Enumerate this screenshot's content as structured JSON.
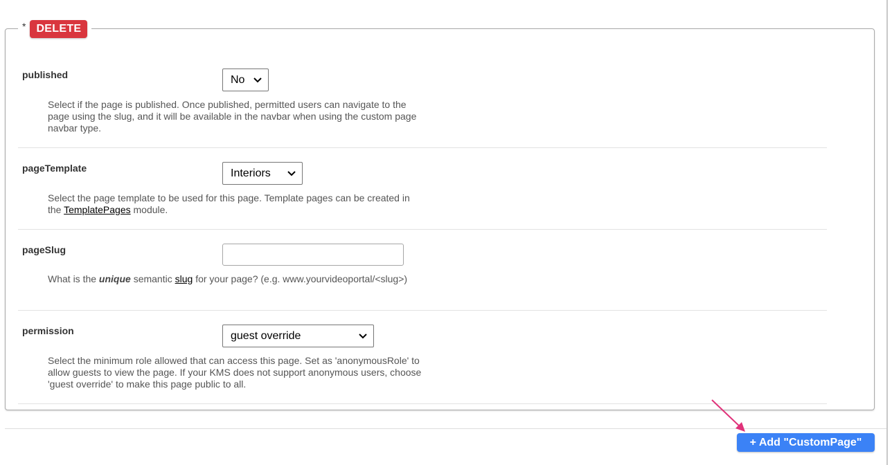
{
  "legend": {
    "asterisk": "*",
    "delete_label": "DELETE"
  },
  "fields": [
    {
      "label": "published",
      "control": "select",
      "value": "No",
      "description": "Select if the page is published. Once published, permitted users can navigate to the page using the slug, and it will be available in the navbar when using the custom page navbar type."
    },
    {
      "label": "pageTemplate",
      "control": "select",
      "value": "Interiors",
      "description_before": "Select the page template to be used for this page. Template pages can be created in the ",
      "description_link": "TemplatePages",
      "description_after": " module."
    },
    {
      "label": "pageSlug",
      "control": "text",
      "value": "",
      "description_part1": "What is the ",
      "description_emphasis": "unique",
      "description_part2": " semantic ",
      "description_link": "slug",
      "description_part3": " for your page? (e.g. www.yourvideoportal/<slug>)"
    },
    {
      "label": "permission",
      "control": "select",
      "value": "guest override",
      "description": "Select the minimum role allowed that can access this page. Set as 'anonymousRole' to allow guests to view the page. If your KMS does not support anonymous users, choose 'guest override' to make this page public to all."
    }
  ],
  "add_button_label": "+ Add \"CustomPage\"",
  "colors": {
    "delete": "#d9363e",
    "add": "#3b82f6",
    "arrow": "#e0337a"
  },
  "icons": {
    "select_chevron": "chevron-down-icon",
    "annotation": "arrow-pointer-icon"
  }
}
